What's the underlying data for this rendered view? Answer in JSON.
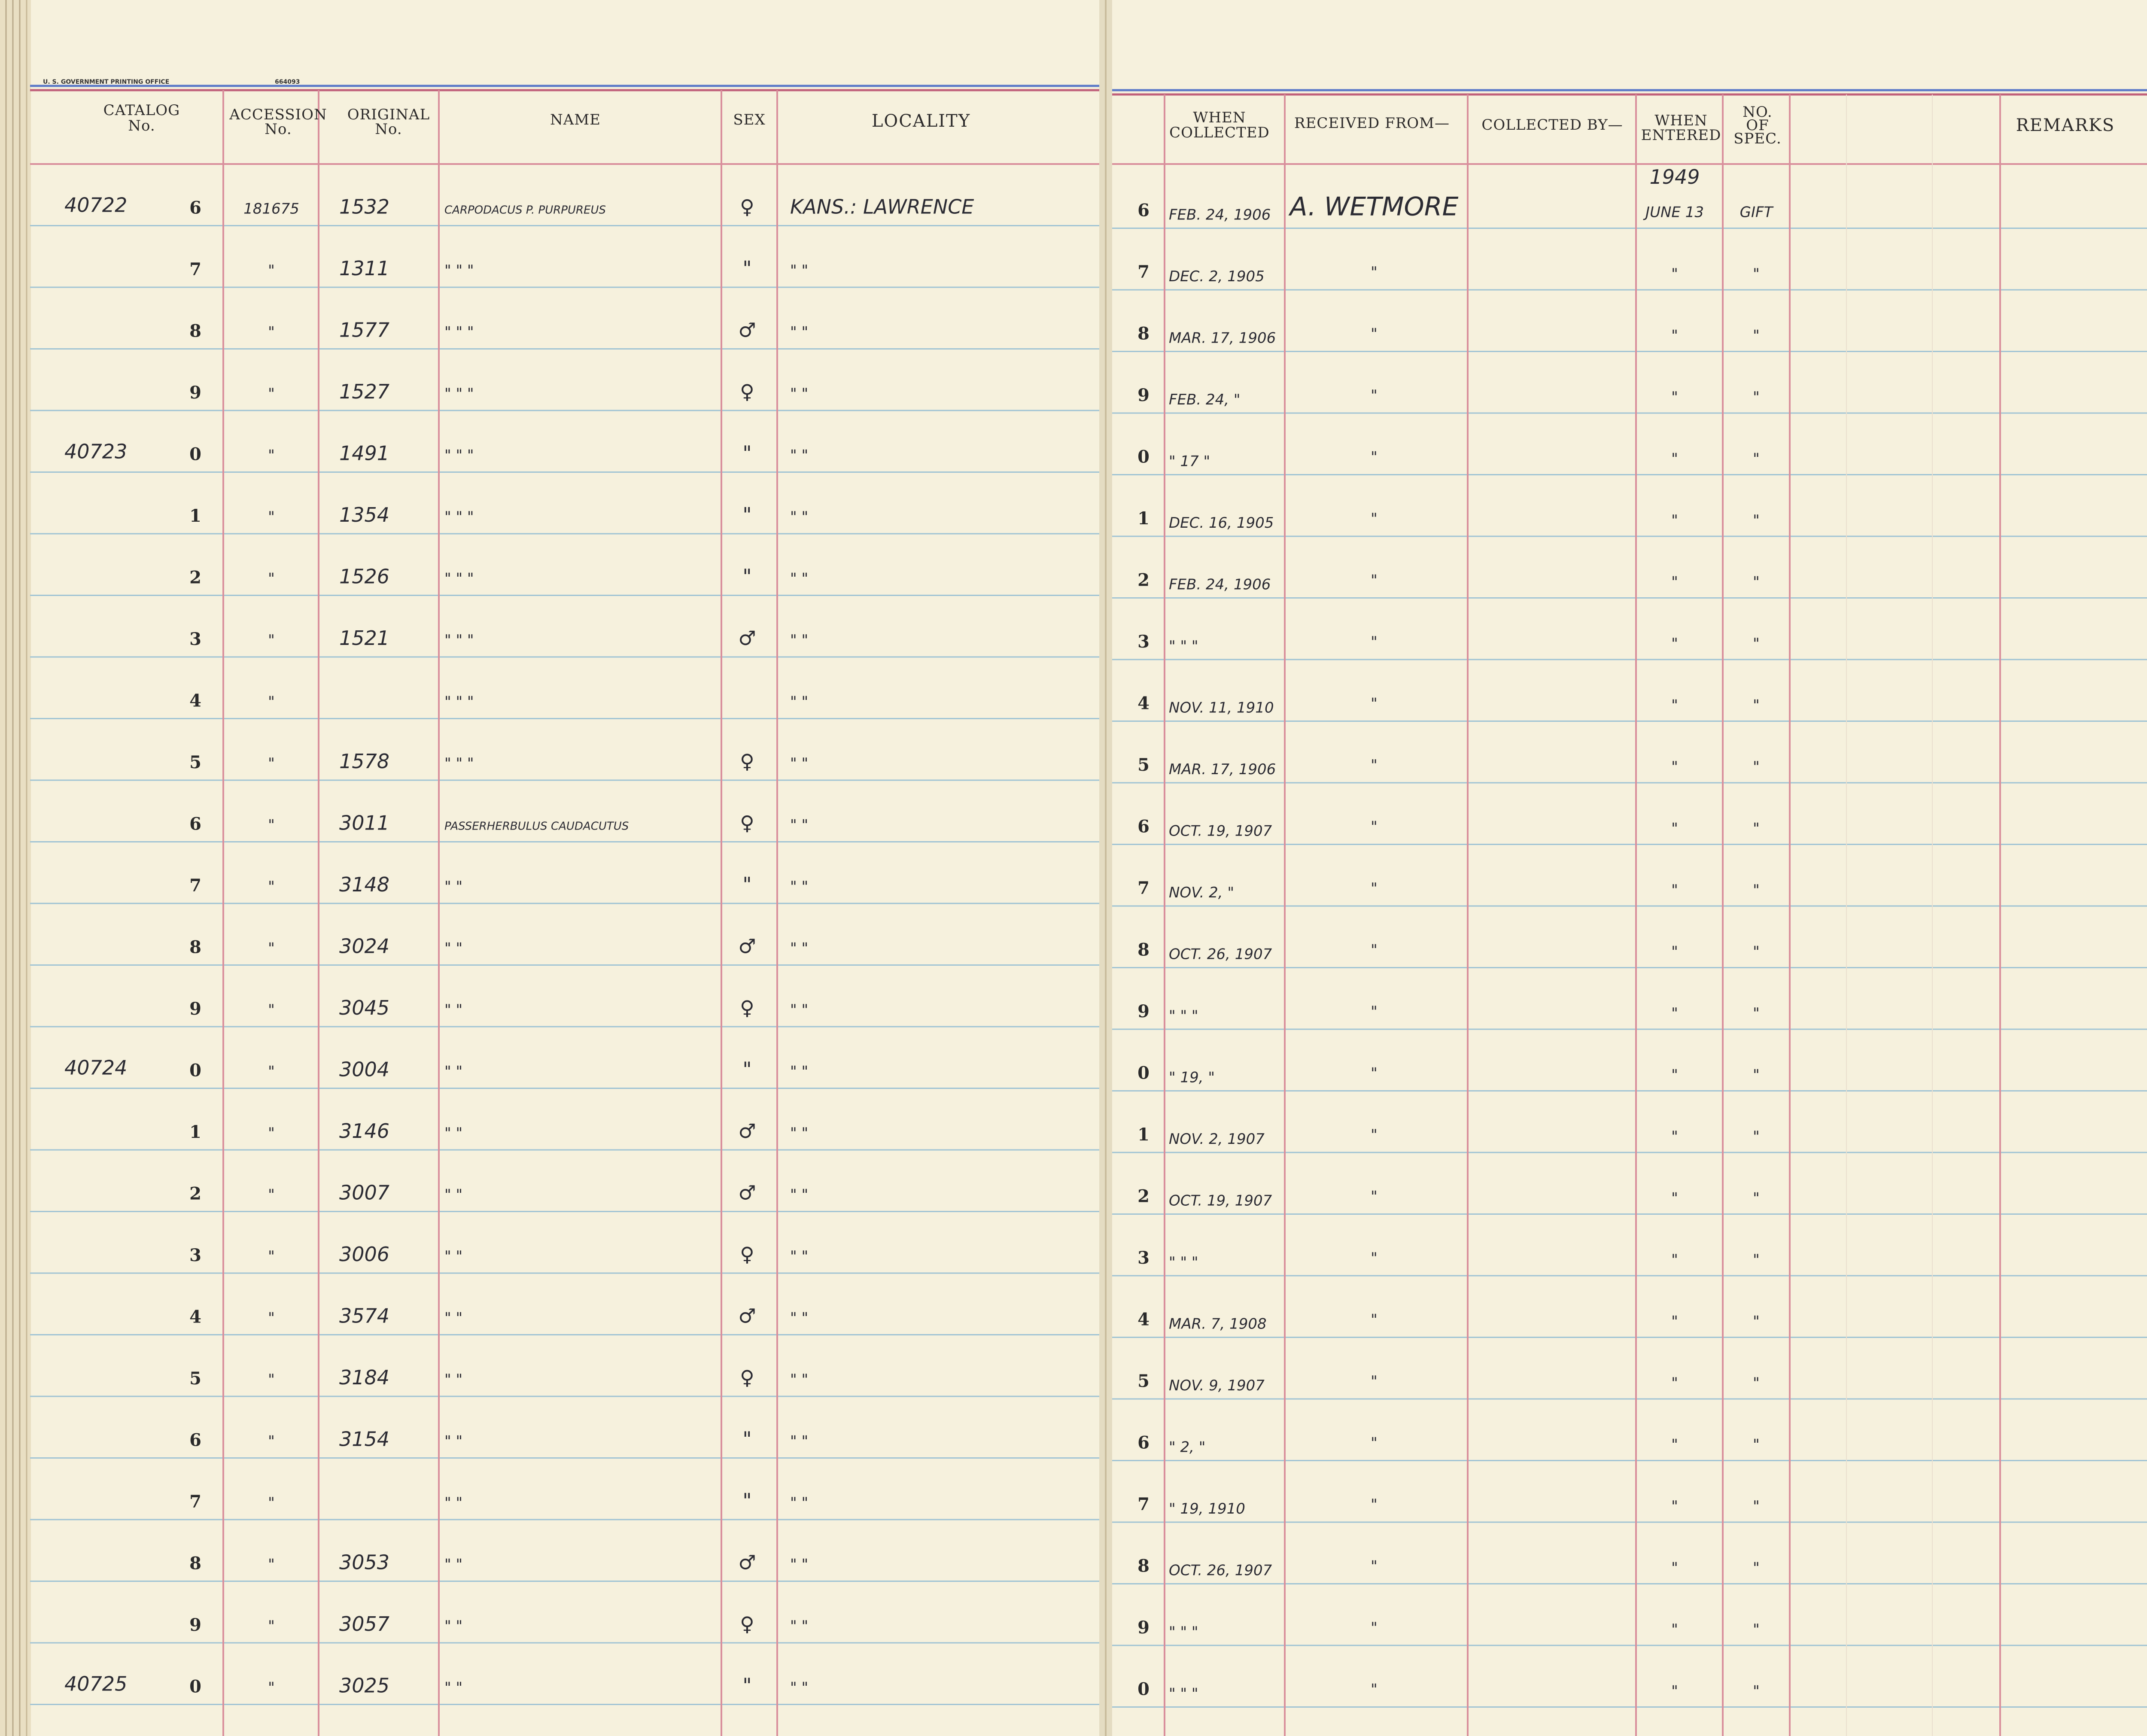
{
  "header": {
    "printer": "U. S. GOVERNMENT PRINTING OFFICE",
    "form_number": "664093",
    "left_columns": {
      "catalog": [
        "CATALOG",
        "No."
      ],
      "accession": [
        "ACCESSION",
        "No."
      ],
      "original": [
        "ORIGINAL",
        "No."
      ],
      "name": "NAME",
      "sex": "SEX",
      "locality": "LOCALITY"
    },
    "right_columns": {
      "when_collected": [
        "WHEN",
        "COLLECTED"
      ],
      "received_from": "RECEIVED FROM—",
      "collected_by": "COLLECTED BY—",
      "when_entered": [
        "WHEN",
        "ENTERED"
      ],
      "no_of_spec": [
        "NO.",
        "OF",
        "SPEC."
      ],
      "remarks": "REMARKS"
    }
  },
  "year_entered": "1949",
  "rows": [
    {
      "row": "6",
      "catalog": "40722",
      "accession": "181675",
      "original": "1532",
      "name": "CARPODACUS P. PURPUREUS",
      "sex": "♀",
      "locality": "KANS.: LAWRENCE",
      "date": "FEB. 24, 1906",
      "received_from": "A. WETMORE",
      "entered": "JUNE 13",
      "spec": "GIFT"
    },
    {
      "row": "7",
      "catalog": "",
      "accession": "\"",
      "original": "1311",
      "name": "\"   \"   \"",
      "sex": "\"",
      "locality": "\"     \"",
      "date": "DEC. 2, 1905",
      "received_from": "\"",
      "entered": "\"",
      "spec": "\""
    },
    {
      "row": "8",
      "catalog": "",
      "accession": "\"",
      "original": "1577",
      "name": "\"   \"   \"",
      "sex": "♂",
      "locality": "\"     \"",
      "date": "MAR. 17, 1906",
      "received_from": "\"",
      "entered": "\"",
      "spec": "\""
    },
    {
      "row": "9",
      "catalog": "",
      "accession": "\"",
      "original": "1527",
      "name": "\"   \"   \"",
      "sex": "♀",
      "locality": "\"     \"",
      "date": "FEB. 24, \"",
      "received_from": "\"",
      "entered": "\"",
      "spec": "\""
    },
    {
      "row": "0",
      "catalog": "40723",
      "accession": "\"",
      "original": "1491",
      "name": "\"   \"   \"",
      "sex": "\"",
      "locality": "\"     \"",
      "date": "\"  17  \"",
      "received_from": "\"",
      "entered": "\"",
      "spec": "\""
    },
    {
      "row": "1",
      "catalog": "",
      "accession": "\"",
      "original": "1354",
      "name": "\"   \"   \"",
      "sex": "\"",
      "locality": "\"     \"",
      "date": "DEC. 16, 1905",
      "received_from": "\"",
      "entered": "\"",
      "spec": "\""
    },
    {
      "row": "2",
      "catalog": "",
      "accession": "\"",
      "original": "1526",
      "name": "\"   \"   \"",
      "sex": "\"",
      "locality": "\"     \"",
      "date": "FEB. 24, 1906",
      "received_from": "\"",
      "entered": "\"",
      "spec": "\""
    },
    {
      "row": "3",
      "catalog": "",
      "accession": "\"",
      "original": "1521",
      "name": "\"   \"   \"",
      "sex": "♂",
      "locality": "\"     \"",
      "date": "\"   \"   \"",
      "received_from": "\"",
      "entered": "\"",
      "spec": "\""
    },
    {
      "row": "4",
      "catalog": "",
      "accession": "\"",
      "original": "",
      "name": "\"   \"   \"",
      "sex": "",
      "locality": "\"     \"",
      "date": "NOV. 11, 1910",
      "received_from": "\"",
      "entered": "\"",
      "spec": "\""
    },
    {
      "row": "5",
      "catalog": "",
      "accession": "\"",
      "original": "1578",
      "name": "\"   \"   \"",
      "sex": "♀",
      "locality": "\"     \"",
      "date": "MAR. 17, 1906",
      "received_from": "\"",
      "entered": "\"",
      "spec": "\""
    },
    {
      "row": "6",
      "catalog": "",
      "accession": "\"",
      "original": "3011",
      "name": "PASSERHERBULUS CAUDACUTUS",
      "sex": "♀",
      "locality": "\"     \"",
      "date": "OCT. 19, 1907",
      "received_from": "\"",
      "entered": "\"",
      "spec": "\""
    },
    {
      "row": "7",
      "catalog": "",
      "accession": "\"",
      "original": "3148",
      "name": "\"     \"",
      "sex": "\"",
      "locality": "\"     \"",
      "date": "NOV. 2, \"",
      "received_from": "\"",
      "entered": "\"",
      "spec": "\""
    },
    {
      "row": "8",
      "catalog": "",
      "accession": "\"",
      "original": "3024",
      "name": "\"     \"",
      "sex": "♂",
      "locality": "\"     \"",
      "date": "OCT. 26, 1907",
      "received_from": "\"",
      "entered": "\"",
      "spec": "\""
    },
    {
      "row": "9",
      "catalog": "",
      "accession": "\"",
      "original": "3045",
      "name": "\"     \"",
      "sex": "♀",
      "locality": "\"     \"",
      "date": "\"   \"   \"",
      "received_from": "\"",
      "entered": "\"",
      "spec": "\""
    },
    {
      "row": "0",
      "catalog": "40724",
      "accession": "\"",
      "original": "3004",
      "name": "\"     \"",
      "sex": "\"",
      "locality": "\"     \"",
      "date": "\" 19, \"",
      "received_from": "\"",
      "entered": "\"",
      "spec": "\""
    },
    {
      "row": "1",
      "catalog": "",
      "accession": "\"",
      "original": "3146",
      "name": "\"     \"",
      "sex": "♂",
      "locality": "\"     \"",
      "date": "NOV. 2, 1907",
      "received_from": "\"",
      "entered": "\"",
      "spec": "\""
    },
    {
      "row": "2",
      "catalog": "",
      "accession": "\"",
      "original": "3007",
      "name": "\"     \"",
      "sex": "♂",
      "locality": "\"     \"",
      "date": "OCT. 19, 1907",
      "received_from": "\"",
      "entered": "\"",
      "spec": "\""
    },
    {
      "row": "3",
      "catalog": "",
      "accession": "\"",
      "original": "3006",
      "name": "\"     \"",
      "sex": "♀",
      "locality": "\"     \"",
      "date": "\"   \"   \"",
      "received_from": "\"",
      "entered": "\"",
      "spec": "\""
    },
    {
      "row": "4",
      "catalog": "",
      "accession": "\"",
      "original": "3574",
      "name": "\"     \"",
      "sex": "♂",
      "locality": "\"     \"",
      "date": "MAR. 7, 1908",
      "received_from": "\"",
      "entered": "\"",
      "spec": "\""
    },
    {
      "row": "5",
      "catalog": "",
      "accession": "\"",
      "original": "3184",
      "name": "\"     \"",
      "sex": "♀",
      "locality": "\"     \"",
      "date": "NOV. 9, 1907",
      "received_from": "\"",
      "entered": "\"",
      "spec": "\""
    },
    {
      "row": "6",
      "catalog": "",
      "accession": "\"",
      "original": "3154",
      "name": "\"     \"",
      "sex": "\"",
      "locality": "\"     \"",
      "date": "\"  2,  \"",
      "received_from": "\"",
      "entered": "\"",
      "spec": "\""
    },
    {
      "row": "7",
      "catalog": "",
      "accession": "\"",
      "original": "",
      "name": "\"     \"",
      "sex": "\"",
      "locality": "\"     \"",
      "date": "\" 19, 1910",
      "received_from": "\"",
      "entered": "\"",
      "spec": "\""
    },
    {
      "row": "8",
      "catalog": "",
      "accession": "\"",
      "original": "3053",
      "name": "\"     \"",
      "sex": "♂",
      "locality": "\"     \"",
      "date": "OCT. 26, 1907",
      "received_from": "\"",
      "entered": "\"",
      "spec": "\""
    },
    {
      "row": "9",
      "catalog": "",
      "accession": "\"",
      "original": "3057",
      "name": "\"     \"",
      "sex": "♀",
      "locality": "\"     \"",
      "date": "\"   \"   \"",
      "received_from": "\"",
      "entered": "\"",
      "spec": "\""
    },
    {
      "row": "0",
      "catalog": "40725",
      "accession": "\"",
      "original": "3025",
      "name": "\"     \"",
      "sex": "\"",
      "locality": "\"     \"",
      "date": "\"   \"   \"",
      "received_from": "\"",
      "entered": "\"",
      "spec": "\""
    }
  ]
}
